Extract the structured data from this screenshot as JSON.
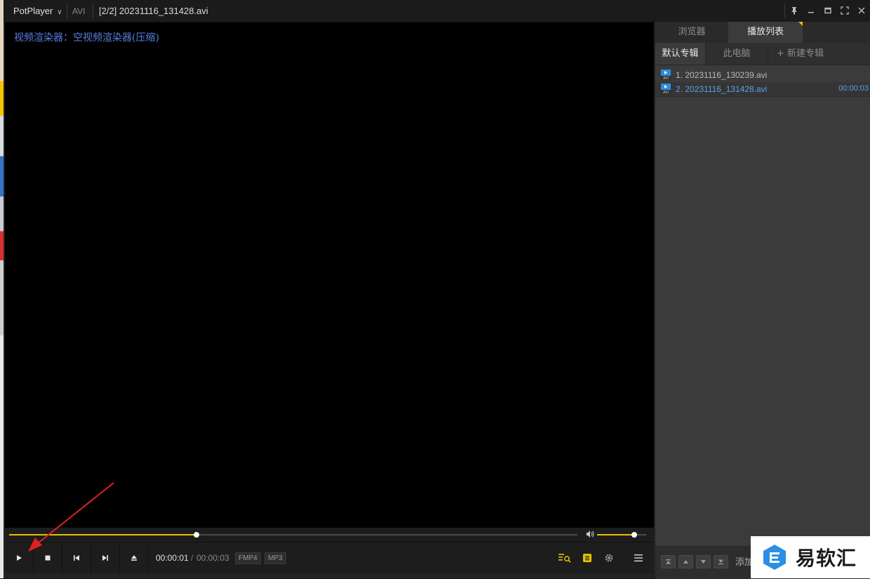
{
  "titlebar": {
    "app_name": "PotPlayer",
    "format": "AVI",
    "title": "[2/2] 20231116_131428.avi",
    "window_buttons": [
      "pin-icon",
      "minimize-icon",
      "maximize-icon",
      "fullscreen-icon",
      "close-icon"
    ]
  },
  "video": {
    "osd_text": "视频渲染器：空视频渲染器(压缩)"
  },
  "playback": {
    "seek_fraction": 0.33,
    "volume_fraction": 0.75,
    "current_time": "00:00:01",
    "separator": "/",
    "total_time": "00:00:03",
    "tags": [
      "FMP4",
      "MP3"
    ]
  },
  "panel": {
    "top_tabs": [
      {
        "label": "浏览器",
        "active": false
      },
      {
        "label": "播放列表",
        "active": true
      }
    ],
    "sub_tabs": [
      {
        "label": "默认专辑",
        "active": true
      },
      {
        "label": "此电脑",
        "active": false
      },
      {
        "label": "+ 新建专辑",
        "active": false
      }
    ],
    "playlist": [
      {
        "name": "1. 20231116_130239.avi",
        "duration": "",
        "selected": false
      },
      {
        "name": "2. 20231116_131428.avi",
        "duration": "00:00:03",
        "selected": true
      }
    ],
    "bottom_add_label": "添加"
  },
  "watermark": {
    "text": "易软汇"
  },
  "colors": {
    "accent": "#e6c200",
    "osd_text": "#5b7de0",
    "selected_item": "#5aa0e8",
    "video_bg": "#000000",
    "annotation_arrow": "#e02020"
  }
}
